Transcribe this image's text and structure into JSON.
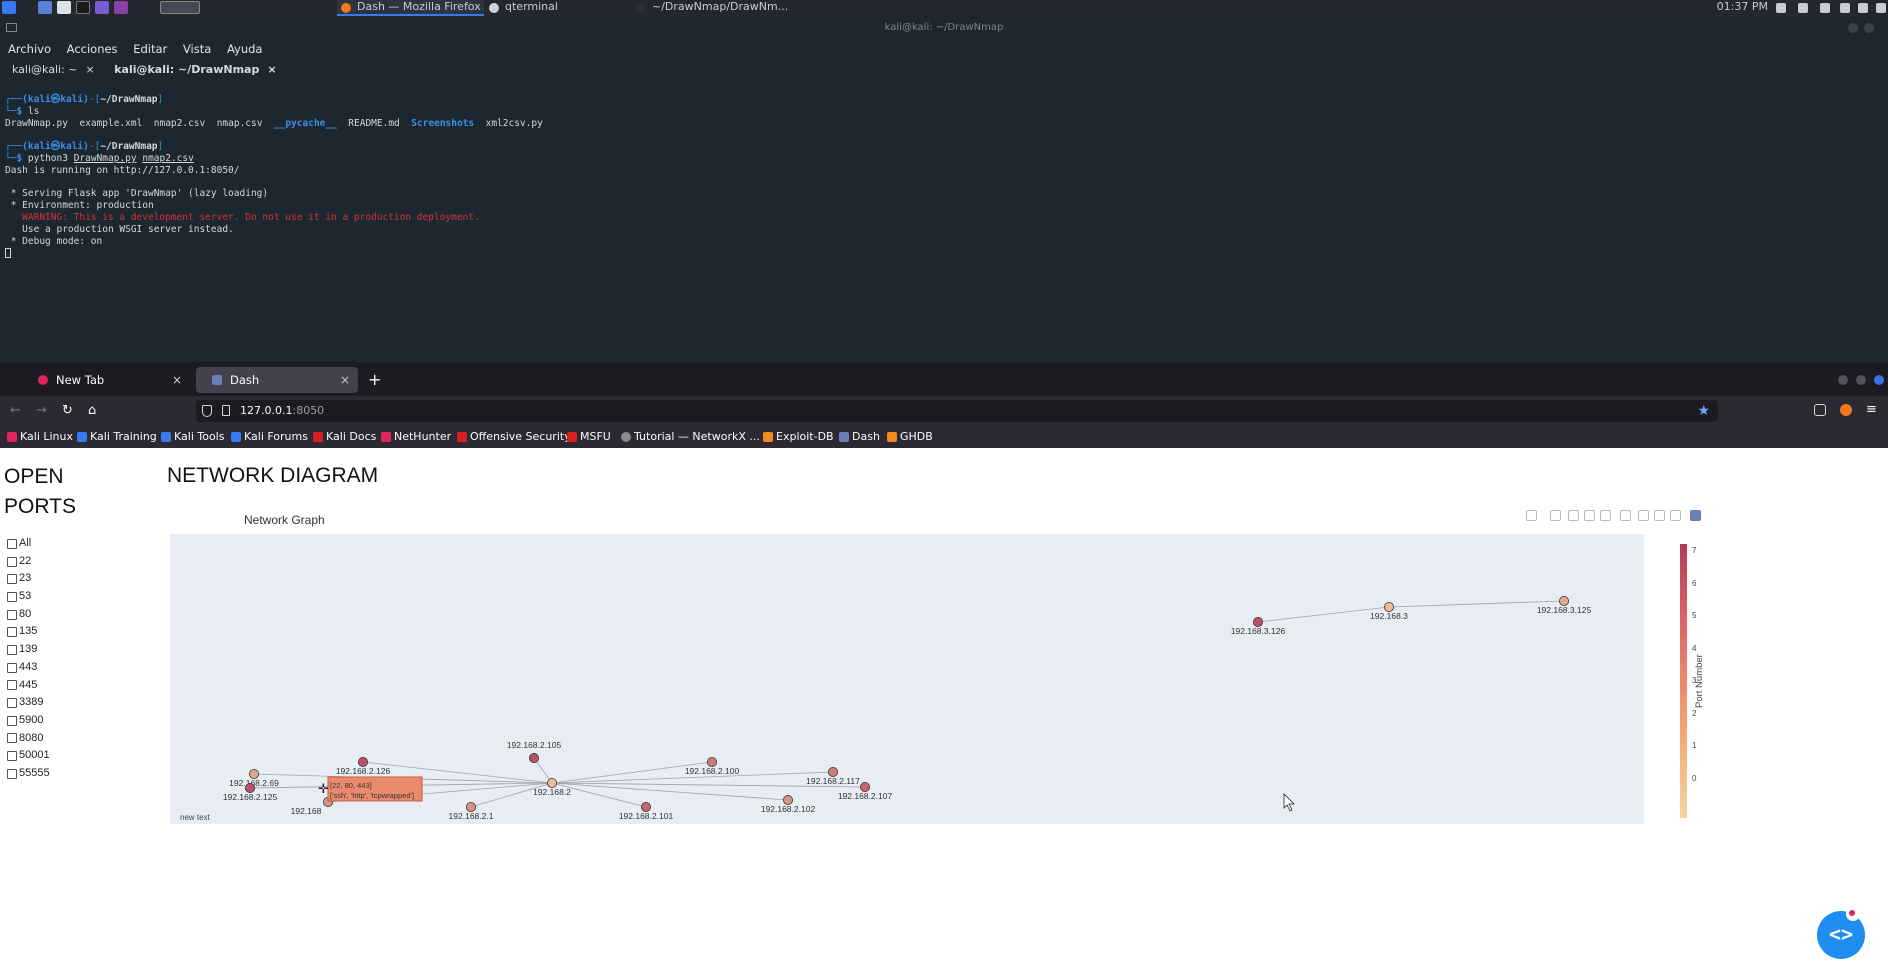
{
  "taskbar": {
    "tasks": [
      {
        "label": "Dash — Mozilla Firefox",
        "active": true
      },
      {
        "label": "qterminal",
        "active": false
      },
      {
        "label": "~/DrawNmap/DrawNm...",
        "active": false
      }
    ],
    "clock": "01:37 PM"
  },
  "terminal": {
    "window_title": "kali@kali: ~/DrawNmap",
    "menu": [
      "Archivo",
      "Acciones",
      "Editar",
      "Vista",
      "Ayuda"
    ],
    "tabs": [
      {
        "label": "kali@kali: ~",
        "close": "×"
      },
      {
        "label": "kali@kali: ~/DrawNmap",
        "close": "×"
      }
    ],
    "prompt_user": "(kali㉿kali)",
    "prompt_dir": "~/DrawNmap",
    "cmd1": "ls",
    "ls_files": [
      "DrawNmap.py",
      "example.xml",
      "nmap2.csv",
      "nmap.csv"
    ],
    "ls_dirs": [
      "__pycache__"
    ],
    "ls_readme": "README.md",
    "ls_dir2": "Screenshots",
    "ls_last": "xml2csv.py",
    "cmd2_prefix": "python3",
    "cmd2_arg1": "DrawNmap.py",
    "cmd2_arg2": "nmap2.csv",
    "out_running": "Dash is running on http://127.0.0.1:8050/",
    "out_serving": " * Serving Flask app 'DrawNmap' (lazy loading)",
    "out_env": " * Environment: production",
    "out_warning": "   WARNING: This is a development server. Do not use it in a production deployment.",
    "out_wsgi": "   Use a production WSGI server instead.",
    "out_debug": " * Debug mode: on"
  },
  "firefox": {
    "tabs": [
      {
        "label": "New Tab",
        "close": "×"
      },
      {
        "label": "Dash",
        "close": "×"
      }
    ],
    "newtab": "+",
    "url_host": "127.0.0.1",
    "url_port": ":8050",
    "bookmarks": [
      {
        "label": "Kali Linux",
        "color": "#e0245e"
      },
      {
        "label": "Kali Training",
        "color": "#367bf0"
      },
      {
        "label": "Kali Tools",
        "color": "#367bf0"
      },
      {
        "label": "Kali Forums",
        "color": "#367bf0"
      },
      {
        "label": "Kali Docs",
        "color": "#d92020"
      },
      {
        "label": "NetHunter",
        "color": "#e0245e"
      },
      {
        "label": "Offensive Security",
        "color": "#d92020"
      },
      {
        "label": "MSFU",
        "color": "#d92020"
      },
      {
        "label": "Tutorial — NetworkX ...",
        "color": "#8a8a8a"
      },
      {
        "label": "Exploit-DB",
        "color": "#f28a1c"
      },
      {
        "label": "Dash",
        "color": "#6a7fb3"
      },
      {
        "label": "GHDB",
        "color": "#f28a1c"
      }
    ]
  },
  "page": {
    "ports_title": "OPEN PORTS",
    "ports": [
      "All",
      "22",
      "23",
      "53",
      "80",
      "135",
      "139",
      "443",
      "445",
      "3389",
      "5900",
      "8080",
      "50001",
      "55555"
    ],
    "network_title": "NETWORK DIAGRAM",
    "graph_title": "Network Graph",
    "new_text": "new text",
    "tooltip_line1": "[22, 80, 443]",
    "tooltip_line2": "['ssh', 'http', 'tcpwrapped']",
    "colorbar_title": "Port Number",
    "colorbar_ticks": [
      "7",
      "6",
      "5",
      "4",
      "3",
      "2",
      "1",
      "0"
    ],
    "fab_label": "<>",
    "fab_badge": "1"
  },
  "chart_data": {
    "type": "scatter",
    "title": "Network Graph",
    "colorbar": {
      "title": "Port Number",
      "range": [
        0,
        7
      ],
      "colorscale": [
        "#f3d3a0",
        "#b23b5c"
      ]
    },
    "nodes": [
      {
        "label": "192.168.2.69",
        "port_count": 2
      },
      {
        "label": "192.168.2.125",
        "port_count": 6
      },
      {
        "label": "192.168.2.126",
        "port_count": 6
      },
      {
        "label": "192.168",
        "port_count": 3
      },
      {
        "label": "192.168.2.105",
        "port_count": 6
      },
      {
        "label": "192.168.2",
        "port_count": 1
      },
      {
        "label": "192.168.2.1",
        "port_count": 3
      },
      {
        "label": "192.168.2.101",
        "port_count": 5
      },
      {
        "label": "192.168.2.100",
        "port_count": 4
      },
      {
        "label": "192.168.2.102",
        "port_count": 3
      },
      {
        "label": "192.168.2.117",
        "port_count": 4
      },
      {
        "label": "192.168.2.107",
        "port_count": 5
      },
      {
        "label": "192.168.3.126",
        "port_count": 6
      },
      {
        "label": "192.168.3",
        "port_count": 1
      },
      {
        "label": "192.168.3.125",
        "port_count": 2
      }
    ],
    "edges": [
      [
        "192.168.2",
        "192.168.2.69"
      ],
      [
        "192.168.2",
        "192.168.2.125"
      ],
      [
        "192.168.2",
        "192.168.2.126"
      ],
      [
        "192.168.2",
        "192.168"
      ],
      [
        "192.168.2",
        "192.168.2.105"
      ],
      [
        "192.168.2",
        "192.168.2.1"
      ],
      [
        "192.168.2",
        "192.168.2.101"
      ],
      [
        "192.168.2",
        "192.168.2.100"
      ],
      [
        "192.168.2",
        "192.168.2.102"
      ],
      [
        "192.168.2",
        "192.168.2.117"
      ],
      [
        "192.168.2",
        "192.168.2.107"
      ],
      [
        "192.168.3",
        "192.168.3.126"
      ],
      [
        "192.168.3",
        "192.168.3.125"
      ]
    ]
  }
}
